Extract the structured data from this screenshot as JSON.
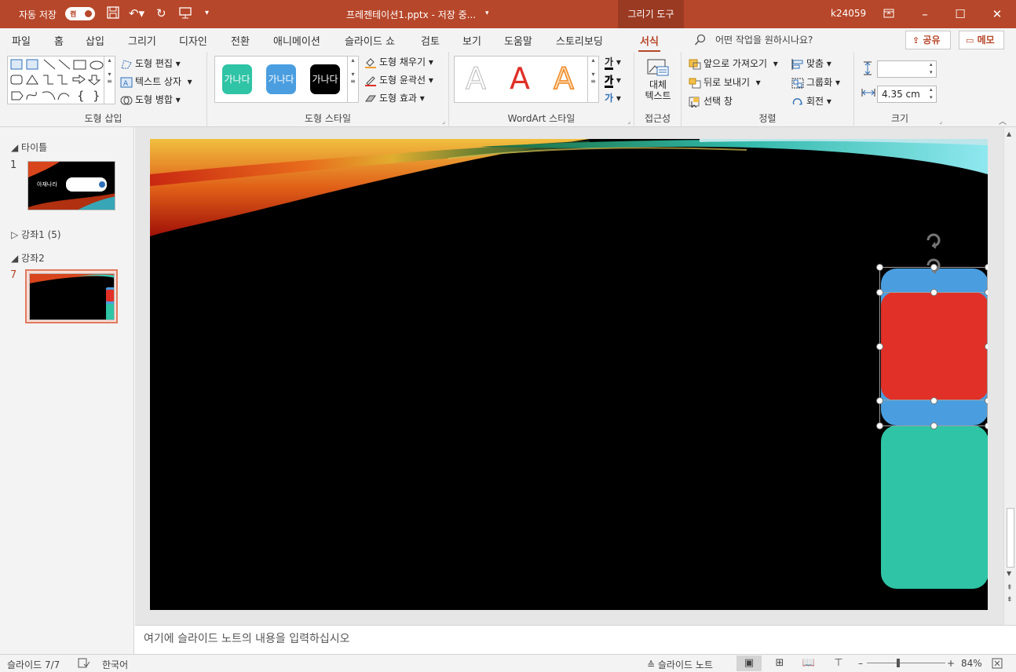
{
  "titlebar": {
    "autosave_label": "자동 저장",
    "autosave_state": "켬",
    "document_title": "프레젠테이션1.pptx - 저장 중...",
    "tools_tab": "그리기 도구",
    "user": "k24059"
  },
  "tabs": [
    "파일",
    "홈",
    "삽입",
    "그리기",
    "디자인",
    "전환",
    "애니메이션",
    "슬라이드 쇼",
    "검토",
    "보기",
    "도움말",
    "스토리보딩",
    "서식"
  ],
  "active_tab": "서식",
  "tell_me": "어떤 작업을 원하시나요?",
  "share_button": "공유",
  "comments_button": "메모",
  "ribbon": {
    "insert_shapes": {
      "label": "도형 삽입",
      "edit_shape": "도형 편집",
      "text_box": "텍스트 상자",
      "merge_shapes": "도형 병합"
    },
    "shape_styles": {
      "label": "도형 스타일",
      "swatch_text": "가나다",
      "swatch_colors": [
        "#2ec4a5",
        "#4a9ee0",
        "#000000"
      ],
      "fill": "도형 채우기",
      "outline": "도형 윤곽선",
      "effects": "도형 효과"
    },
    "wordart": {
      "label": "WordArt 스타일",
      "glyph": "A",
      "text_glyph": "가"
    },
    "accessibility": {
      "label": "접근성",
      "alt_text_line1": "대체",
      "alt_text_line2": "텍스트"
    },
    "arrange": {
      "label": "정렬",
      "bring_forward": "앞으로 가져오기",
      "send_backward": "뒤로 보내기",
      "selection_pane": "선택 창",
      "align": "맞춤",
      "group": "그룹화",
      "rotate": "회전"
    },
    "size": {
      "label": "크기",
      "height": "",
      "width": "4.35 cm"
    }
  },
  "thumbnails": {
    "section1": "타이틀",
    "slide1_number": "1",
    "slide1_caption": "아재나라",
    "section2": "강좌1 (5)",
    "section3": "강좌2",
    "slide7_number": "7"
  },
  "notes_placeholder": "여기에 슬라이드 노트의 내용을 입력하십시오",
  "status": {
    "slide_info": "슬라이드 7/7",
    "language": "한국어",
    "notes_button": "슬라이드 노트",
    "zoom": "84%"
  },
  "colors": {
    "accent": "#b7472a",
    "shape_blue": "#4a9ee0",
    "shape_red": "#e03028",
    "shape_teal": "#2ec4a5"
  }
}
